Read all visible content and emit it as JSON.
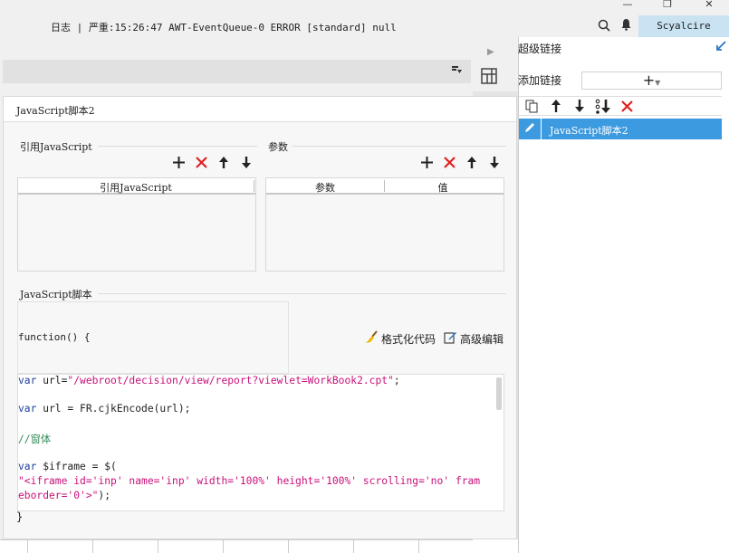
{
  "titlebar": {
    "log": "日志 | 严重:15:26:47 AWT-EventQueue-0 ERROR [standard] null",
    "user": "Scyalcire",
    "search_icon": "search-icon",
    "bell_icon": "bell-icon",
    "min": "—",
    "restore": "❐",
    "close": "✕"
  },
  "editor": {
    "title": "JavaScript脚本2",
    "ref_js": {
      "label": "引用JavaScript",
      "column": "引用JavaScript"
    },
    "params": {
      "label": "参数",
      "columns": [
        "参数",
        "值"
      ]
    },
    "script": {
      "label": "JavaScript脚本",
      "func_head": "function() {",
      "format_label": "格式化代码",
      "advanced_label": "高级编辑",
      "lines": [
        "var url=\"/webroot/decision/view/report?viewlet=WorkBook2.cpt\";",
        "",
        "var url = FR.cjkEncode(url);",
        "",
        "//窗体",
        "",
        "var $iframe = $(",
        "\"<iframe id='inp' name='inp' width='100%' height='100%' scrolling='no' fram",
        "eborder='0'>\");"
      ],
      "brace_end": "}"
    }
  },
  "right_panel": {
    "title": "超级链接",
    "add_label": "添加链接",
    "add_symbol": "+",
    "items": [
      "JavaScript脚本2"
    ]
  },
  "colors": {
    "accent": "#3c9ae0",
    "user_box": "#c9e3f3",
    "delete": "#e02020",
    "keyword": "#1f3fa0",
    "string": "#c8107a"
  }
}
